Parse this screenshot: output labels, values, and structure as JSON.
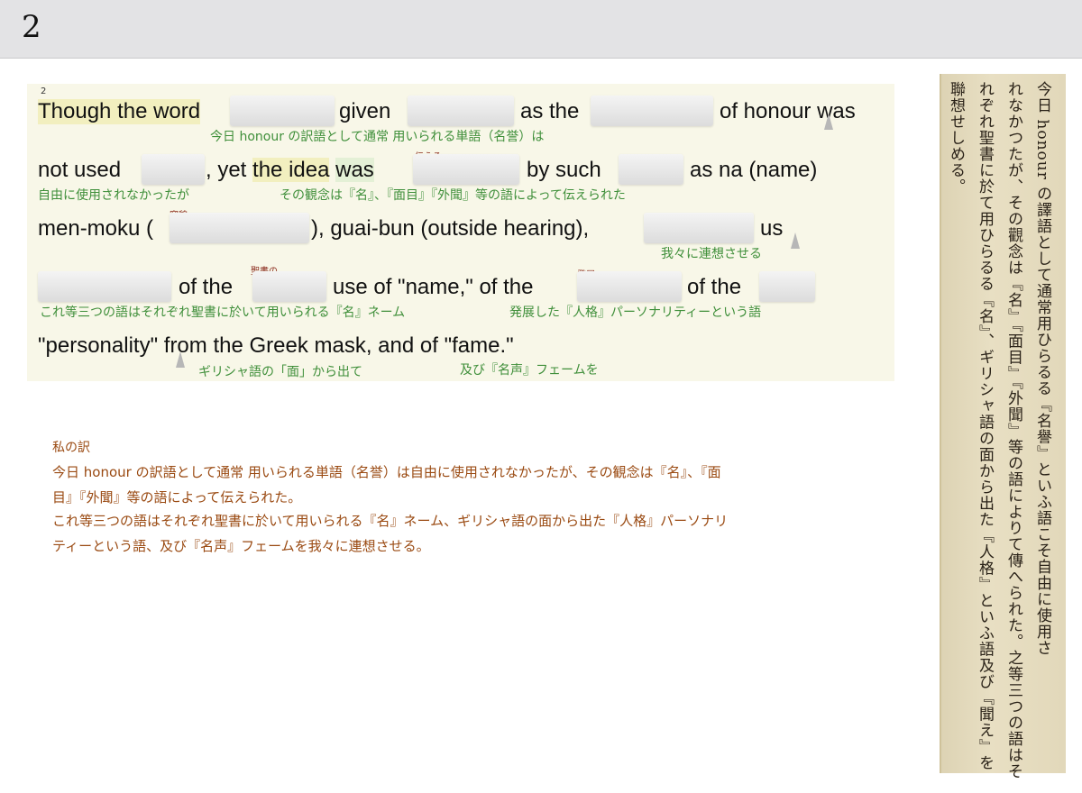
{
  "slide": {
    "number": "2"
  },
  "source": {
    "superscript": "2",
    "line1": {
      "a": "Though the word",
      "b": "given",
      "c": "as the",
      "d": "of honour was",
      "gloss": "今日 honour の訳語として通常 用いられる単語（名誉）は"
    },
    "line2": {
      "a": "not used",
      "b": ",  yet the idea was",
      "c": "by such",
      "d": "as na (name)",
      "ruby": "伝える",
      "gloss1": "自由に使用されなかったが",
      "gloss2": "その観念は『名』、『面目』『外聞』等の語によって伝えられた"
    },
    "line3": {
      "a": "men-moku (",
      "b": "), guai-bun (outside hearing),",
      "c": "us",
      "ruby": "容貌",
      "gloss": "我々に連想させる"
    },
    "line4": {
      "a": "of the",
      "b": "use of \"name,\" of the",
      "c": "of the",
      "ruby1": "聖書の",
      "ruby2": "発展",
      "gloss1": "これ等三つの語はそれぞれ聖書に於いて用いられる『名』ネーム",
      "gloss2": "発展した『人格』パーソナリティーという語"
    },
    "line5": {
      "a": "\"personality\" from the Greek mask, and of \"fame.\"",
      "gloss1": "ギリシャ語の「面」から出て",
      "gloss2": "及び『名声』フェームを"
    }
  },
  "translation": {
    "heading": "私の訳",
    "lines": [
      "今日 honour の訳語として通常 用いられる単語（名誉）は自由に使用されなかったが、その観念は『名』、『面",
      "目』『外聞』等の語によって伝えられた。",
      "これ等三つの語はそれぞれ聖書に於いて用いられる『名』ネーム、ギリシャ語の面から出た『人格』パーソナリ",
      "ティーという語、及び『名声』フェームを我々に連想させる。"
    ]
  },
  "scan": {
    "columns": [
      "今日 honour の譯語として通常用ひらるる『名譽』といふ語こそ自由に使用さ",
      "れなかつたが、その觀念は『名』『面目』『外聞』等の語によりて傳へられた。之等三つの語はそ",
      "れぞれ聖書に於て用ひらるる『名』、ギリシャ語の面から出た『人格』といふ語及び『聞え』を",
      "聯想せしめる。"
    ]
  },
  "colors": {
    "gloss": "#3f8f3a",
    "ruby": "#8a2a1c",
    "translation": "#9a4a12",
    "panel": "#f8f7e8"
  }
}
